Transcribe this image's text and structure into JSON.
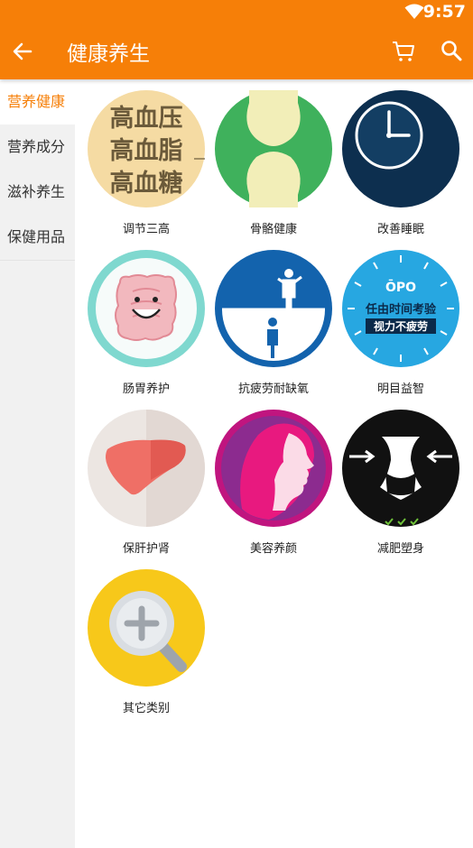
{
  "status_bar": {
    "time": "9:57"
  },
  "header": {
    "title": "健康养生",
    "accent": "#f67f08"
  },
  "icons": {
    "back": "arrow-left-icon",
    "cart": "cart-icon",
    "search": "search-icon",
    "wifi": "wifi-icon"
  },
  "sidebar": {
    "items": [
      {
        "label": "营养健康",
        "active": true
      },
      {
        "label": "营养成分",
        "active": false
      },
      {
        "label": "滋补养生",
        "active": false
      },
      {
        "label": "保健用品",
        "active": false
      }
    ]
  },
  "grid": {
    "items": [
      {
        "label": "调节三高",
        "art": [
          "高血压",
          "高血脂",
          "高血糖"
        ]
      },
      {
        "label": "骨骼健康"
      },
      {
        "label": "改善睡眠"
      },
      {
        "label": "肠胃养护"
      },
      {
        "label": "抗疲劳耐缺氧"
      },
      {
        "label": "明目益智",
        "art": [
          "ŌPO",
          "任由时间考验",
          "视力不疲劳"
        ]
      },
      {
        "label": "保肝护肾"
      },
      {
        "label": "美容养颜"
      },
      {
        "label": "减肥塑身"
      },
      {
        "label": "其它类别"
      }
    ]
  }
}
